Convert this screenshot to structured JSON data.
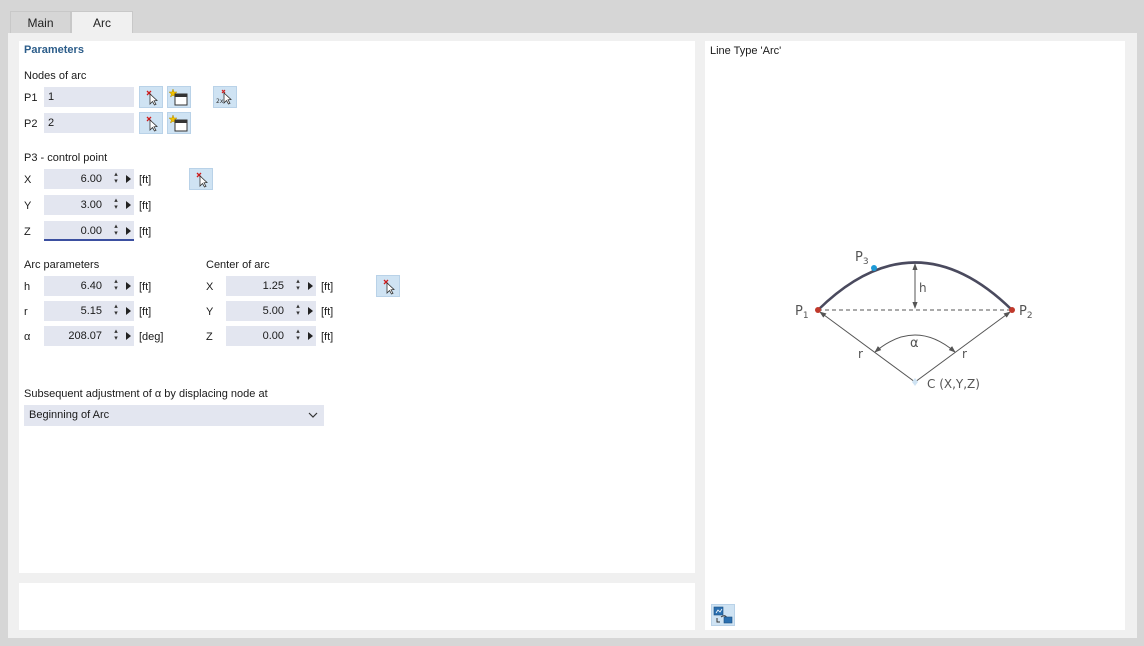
{
  "tabs": [
    {
      "label": "Main",
      "active": false
    },
    {
      "label": "Arc",
      "active": true
    }
  ],
  "parameters": {
    "title": "Parameters",
    "nodes_of_arc": {
      "label": "Nodes of arc",
      "p1": {
        "label": "P1",
        "value": "1"
      },
      "p2": {
        "label": "P2",
        "value": "2"
      }
    },
    "control_point": {
      "label": "P3 - control point",
      "x": {
        "label": "X",
        "value": "6.00",
        "unit": "[ft]"
      },
      "y": {
        "label": "Y",
        "value": "3.00",
        "unit": "[ft]"
      },
      "z": {
        "label": "Z",
        "value": "0.00",
        "unit": "[ft]"
      }
    },
    "arc_parameters": {
      "label": "Arc parameters",
      "h": {
        "label": "h",
        "value": "6.40",
        "unit": "[ft]"
      },
      "r": {
        "label": "r",
        "value": "5.15",
        "unit": "[ft]"
      },
      "alpha": {
        "label": "α",
        "value": "208.07",
        "unit": "[deg]"
      }
    },
    "center_of_arc": {
      "label": "Center of arc",
      "x": {
        "label": "X",
        "value": "1.25",
        "unit": "[ft]"
      },
      "y": {
        "label": "Y",
        "value": "5.00",
        "unit": "[ft]"
      },
      "z": {
        "label": "Z",
        "value": "0.00",
        "unit": "[ft]"
      }
    },
    "adjustment": {
      "label": "Subsequent adjustment of α by displacing node at",
      "selected": "Beginning of Arc"
    }
  },
  "preview": {
    "title": "Line Type 'Arc'",
    "labels": {
      "p1": "P",
      "p1_sub": "1",
      "p2": "P",
      "p2_sub": "2",
      "p3": "P",
      "p3_sub": "3",
      "h": "h",
      "alpha": "α",
      "r_left": "r",
      "r_right": "r",
      "center": "C (X,Y,Z)"
    }
  },
  "colors": {
    "accent": "#2c5d8a",
    "field_bg": "#e3e6f0",
    "icon_btn_bg": "#cfe3f3",
    "arc_line": "#4a4a5e",
    "node_red": "#c0392b",
    "node_blue": "#1e9ad6"
  },
  "icons": [
    "select-node-icon",
    "new-node-icon",
    "pick-two-nodes-icon",
    "chevron-down-icon",
    "diagram-options-icon"
  ]
}
